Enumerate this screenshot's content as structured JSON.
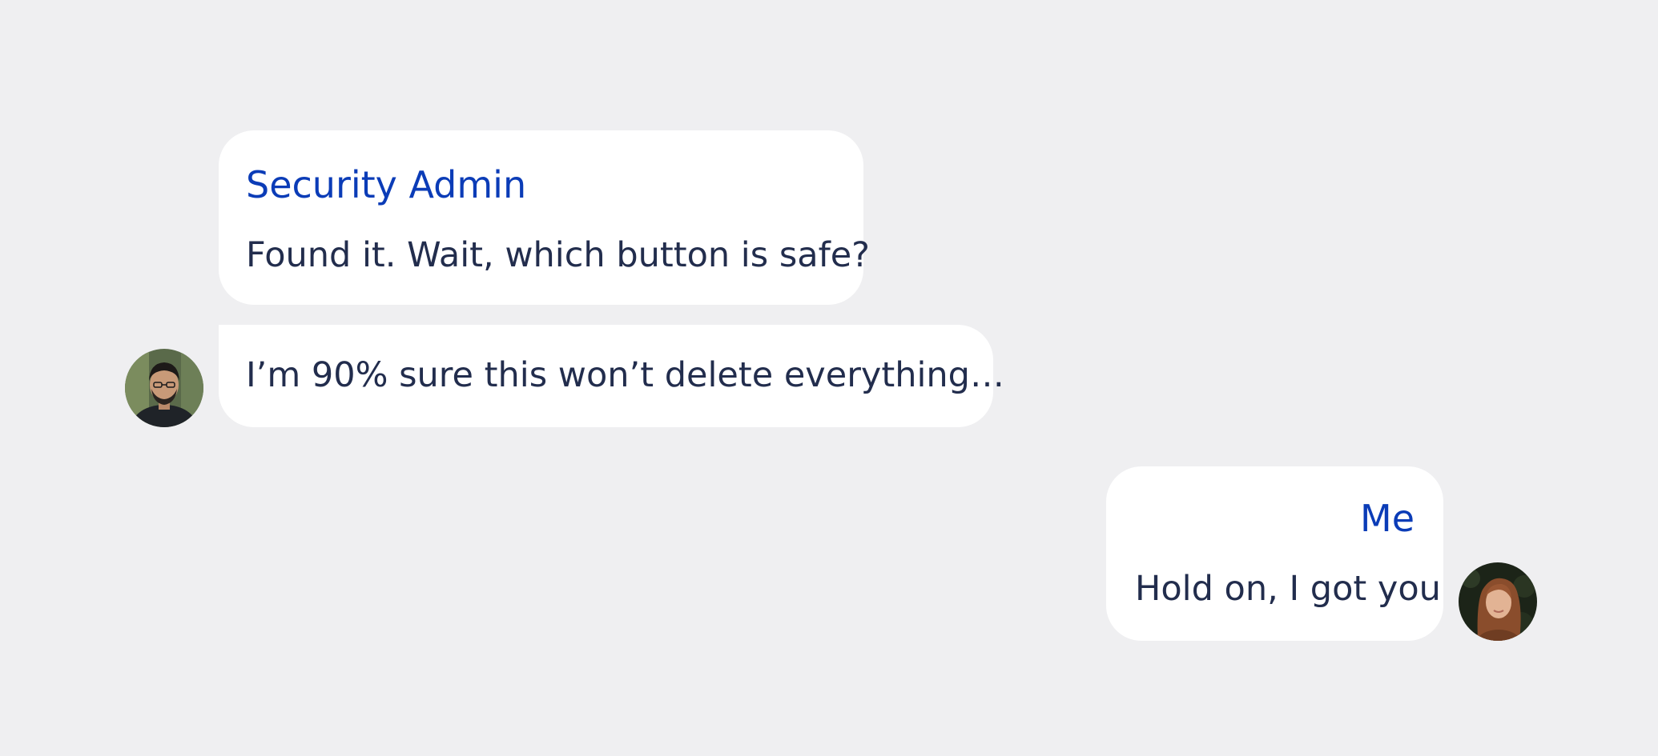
{
  "chat": {
    "messages": [
      {
        "sender": "Security Admin",
        "text": "Found it. Wait, which button is safe?"
      },
      {
        "text": "I’m 90% sure this won’t delete everything…"
      },
      {
        "sender": "Me",
        "text": "Hold on, I got you"
      }
    ]
  },
  "colors": {
    "background": "#efeff1",
    "bubble": "#ffffff",
    "sender_name": "#0b3cb7",
    "message_text": "#222d4d"
  },
  "icons": {
    "admin_avatar": "avatar-photo-man",
    "me_avatar": "avatar-photo-woman"
  }
}
